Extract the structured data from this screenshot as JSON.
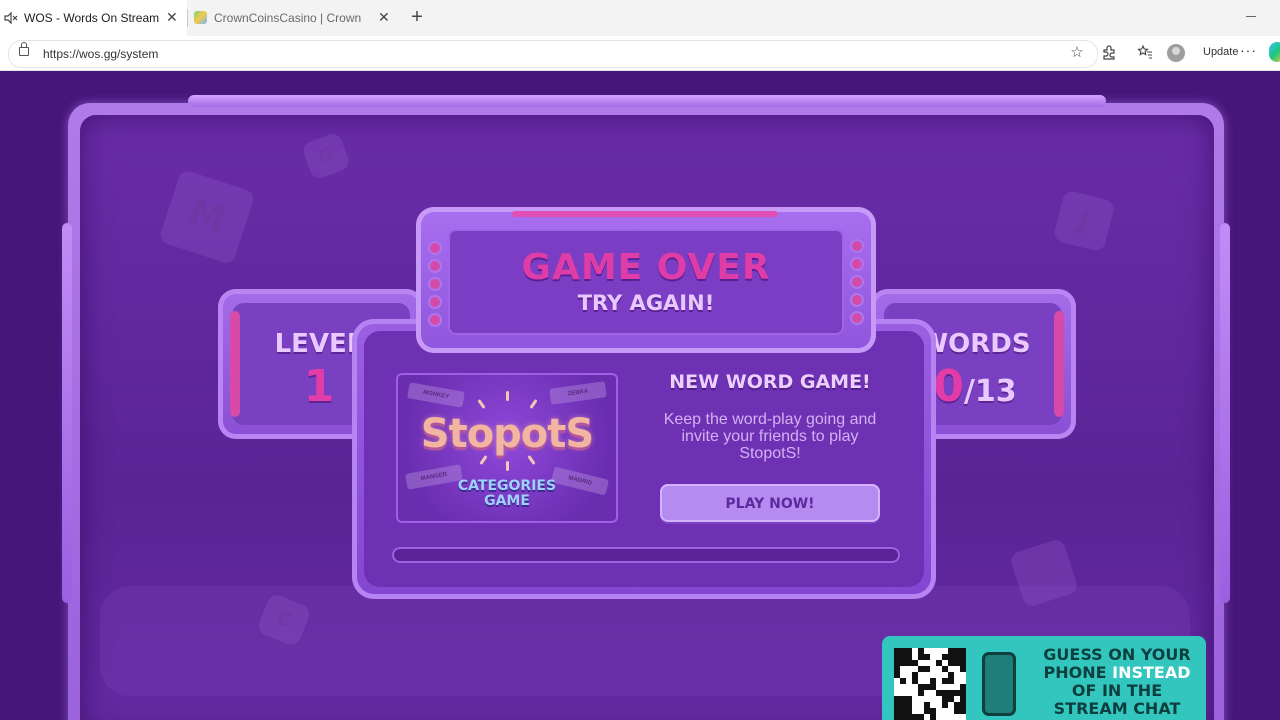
{
  "browser": {
    "tabs": [
      {
        "title": "WOS - Words On Stream",
        "active": true,
        "muted_icon": "muted-speaker-icon"
      },
      {
        "title": "CrownCoinsCasino | Crown Coins C",
        "active": false,
        "icon": "crowncoins-favicon-icon"
      }
    ],
    "url": "https://wos.gg/system",
    "update_label": "Update",
    "more_label": "···"
  },
  "game": {
    "header": {
      "title": "GAME OVER",
      "subtitle": "TRY AGAIN!"
    },
    "level": {
      "label": "LEVEL",
      "value": "1"
    },
    "words": {
      "label": "WORDS",
      "found": "0",
      "separator": "/",
      "total": "13"
    },
    "promo": {
      "title": "NEW WORD GAME!",
      "text": "Keep the word-play going and invite your friends to play StopotS!",
      "button": "PLAY NOW!",
      "image": {
        "logo": "StopotS",
        "subtitle_line1": "CATEGORIES",
        "subtitle_line2": "GAME",
        "tags": [
          "MONKEY",
          "ZEBRA",
          "MANGER",
          "MADRID"
        ]
      }
    },
    "progress": 0.0,
    "background_letters": [
      "M",
      "G",
      "J",
      "S",
      "C"
    ],
    "phone_promo": {
      "line1": "GUESS ON YOUR",
      "line2a": "PHONE",
      "line2b": "INSTEAD",
      "line3": "OF IN THE",
      "line4": "STREAM CHAT"
    }
  },
  "colors": {
    "accent_pink": "#de3ca6",
    "panel_purple": "#6e31b4",
    "teal": "#33c6bf"
  }
}
